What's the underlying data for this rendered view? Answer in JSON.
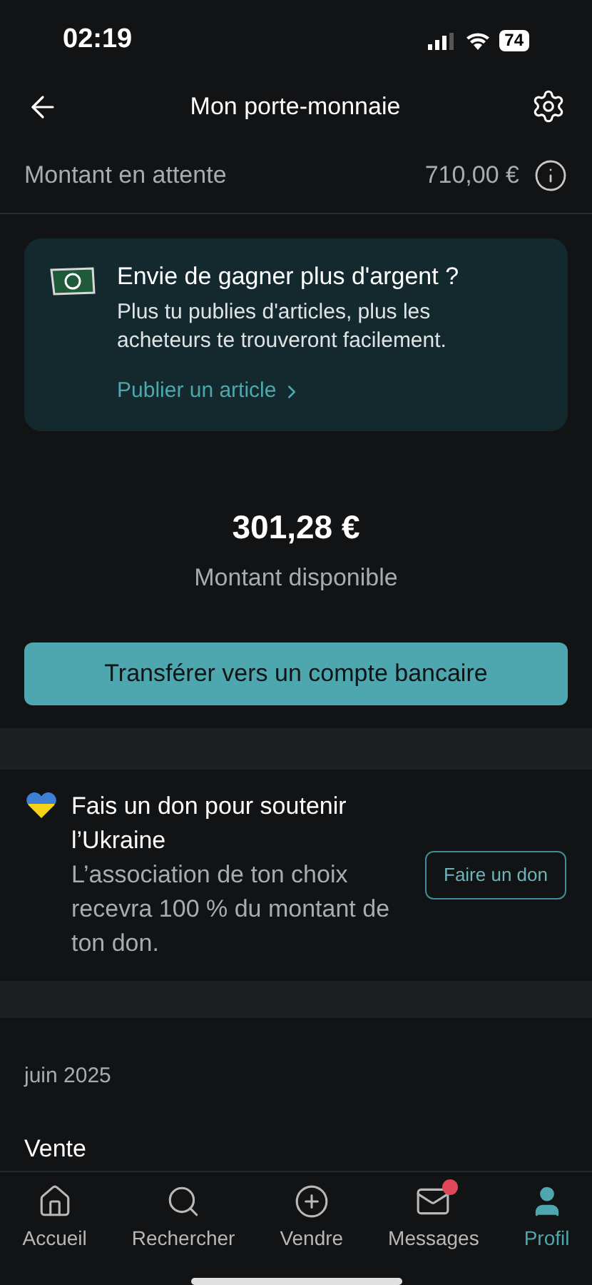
{
  "status_bar": {
    "time": "02:19",
    "battery": "74"
  },
  "header": {
    "title": "Mon porte-monnaie"
  },
  "pending": {
    "label": "Montant en attente",
    "amount": "710,00 €"
  },
  "promo": {
    "title": "Envie de gagner plus d'argent ?",
    "text": "Plus tu publies d'articles, plus les acheteurs te trouveront facilement.",
    "link": "Publier un article"
  },
  "balance": {
    "amount": "301,28 €",
    "label": "Montant disponible",
    "button": "Transférer vers un compte bancaire"
  },
  "donation": {
    "title": "Fais un don pour soutenir l’Ukraine",
    "text": "L’association de ton choix recevra 100 % du montant de ton don.",
    "button": "Faire un don"
  },
  "history": {
    "month": "juin 2025",
    "section": "Vente"
  },
  "tabs": [
    {
      "kind": "home",
      "label": "Accueil",
      "selected": false,
      "badge": false
    },
    {
      "kind": "search",
      "label": "Rechercher",
      "selected": false,
      "badge": false
    },
    {
      "kind": "sell",
      "label": "Vendre",
      "selected": false,
      "badge": false
    },
    {
      "kind": "messages",
      "label": "Messages",
      "selected": false,
      "badge": true
    },
    {
      "kind": "profile",
      "label": "Profil",
      "selected": true,
      "badge": false
    }
  ]
}
